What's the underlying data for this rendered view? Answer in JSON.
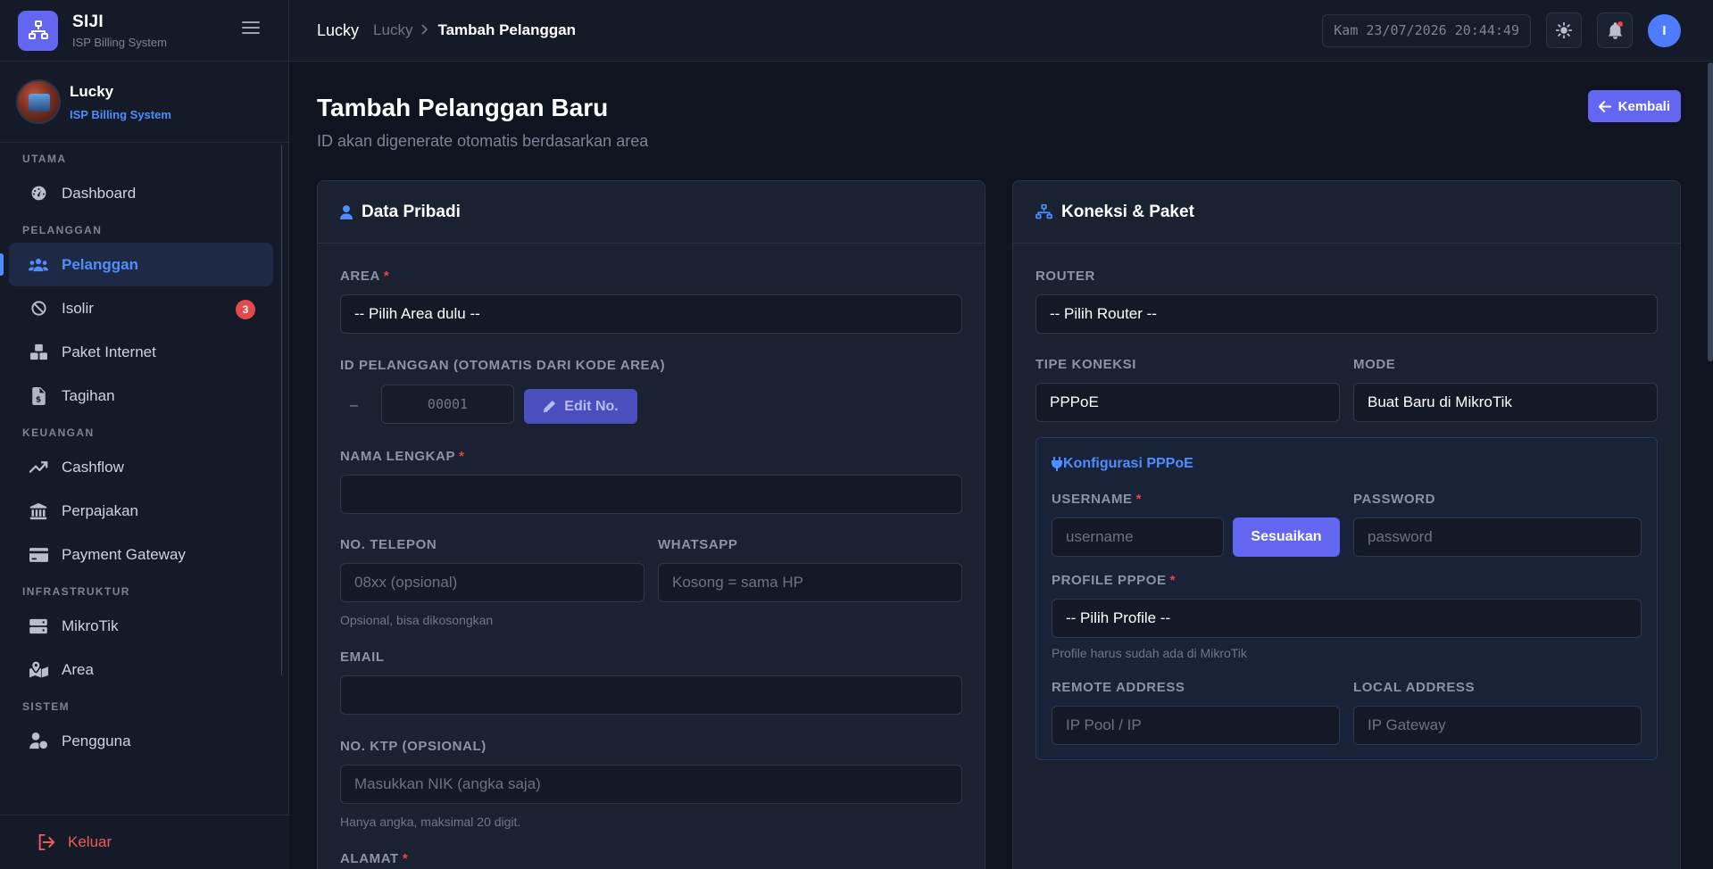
{
  "brand": {
    "name": "SIJI",
    "subtitle": "ISP Billing System"
  },
  "profile": {
    "name": "Lucky",
    "role": "ISP Billing System"
  },
  "sidebar": {
    "sections": [
      {
        "title": "UTAMA",
        "items": [
          {
            "label": "Dashboard",
            "icon": "dashboard-icon"
          }
        ]
      },
      {
        "title": "PELANGGAN",
        "items": [
          {
            "label": "Pelanggan",
            "icon": "users-icon",
            "active": true
          },
          {
            "label": "Isolir",
            "icon": "ban-icon",
            "badge": "3"
          },
          {
            "label": "Paket Internet",
            "icon": "boxes-icon"
          },
          {
            "label": "Tagihan",
            "icon": "invoice-icon"
          }
        ]
      },
      {
        "title": "KEUANGAN",
        "items": [
          {
            "label": "Cashflow",
            "icon": "trend-icon"
          },
          {
            "label": "Perpajakan",
            "icon": "bank-icon"
          },
          {
            "label": "Payment Gateway",
            "icon": "card-icon"
          }
        ]
      },
      {
        "title": "INFRASTRUKTUR",
        "items": [
          {
            "label": "MikroTik",
            "icon": "server-icon"
          },
          {
            "label": "Area",
            "icon": "map-icon"
          }
        ]
      },
      {
        "title": "SISTEM",
        "items": [
          {
            "label": "Pengguna",
            "icon": "user-cog-icon"
          }
        ]
      }
    ],
    "logout_label": "Keluar"
  },
  "topbar": {
    "breadcrumb_root": "Lucky",
    "breadcrumb_mid": "Lucky",
    "breadcrumb_current": "Tambah Pelanggan",
    "clock": "Kam 23/07/2026 20:44:49",
    "avatar_initial": "I"
  },
  "page": {
    "title": "Tambah Pelanggan Baru",
    "subtitle": "ID akan digenerate otomatis berdasarkan area",
    "back_label": "Kembali"
  },
  "personal": {
    "title": "Data Pribadi",
    "area_label": "AREA",
    "area_value": "-- Pilih Area dulu --",
    "id_label": "ID PELANGGAN (OTOMATIS DARI KODE AREA)",
    "id_prefix": "–",
    "id_number": "00001",
    "edit_label": "Edit No.",
    "name_label": "NAMA LENGKAP",
    "phone_label": "NO. TELEPON",
    "phone_placeholder": "08xx (opsional)",
    "phone_help": "Opsional, bisa dikosongkan",
    "wa_label": "WHATSAPP",
    "wa_placeholder": "Kosong = sama HP",
    "email_label": "EMAIL",
    "ktp_label": "NO. KTP (OPSIONAL)",
    "ktp_placeholder": "Masukkan NIK (angka saja)",
    "ktp_help": "Hanya angka, maksimal 20 digit.",
    "address_label": "ALAMAT"
  },
  "connection": {
    "title": "Koneksi & Paket",
    "router_label": "ROUTER",
    "router_value": "-- Pilih Router --",
    "type_label": "TIPE KONEKSI",
    "type_value": "PPPoE",
    "mode_label": "MODE",
    "mode_value": "Buat Baru di MikroTik",
    "pppoe": {
      "title": "Konfigurasi PPPoE",
      "username_label": "USERNAME",
      "username_placeholder": "username",
      "adjust_label": "Sesuaikan",
      "password_label": "PASSWORD",
      "password_placeholder": "password",
      "profile_label": "PROFILE PPPOE",
      "profile_value": "-- Pilih Profile --",
      "profile_help": "Profile harus sudah ada di MikroTik",
      "remote_label": "REMOTE ADDRESS",
      "remote_placeholder": "IP Pool / IP",
      "local_label": "LOCAL ADDRESS",
      "local_placeholder": "IP Gateway"
    }
  },
  "colors": {
    "accent": "#4f8dff",
    "primary_button": "#6366f1",
    "danger": "#ef4444",
    "background": "#0f1420"
  }
}
